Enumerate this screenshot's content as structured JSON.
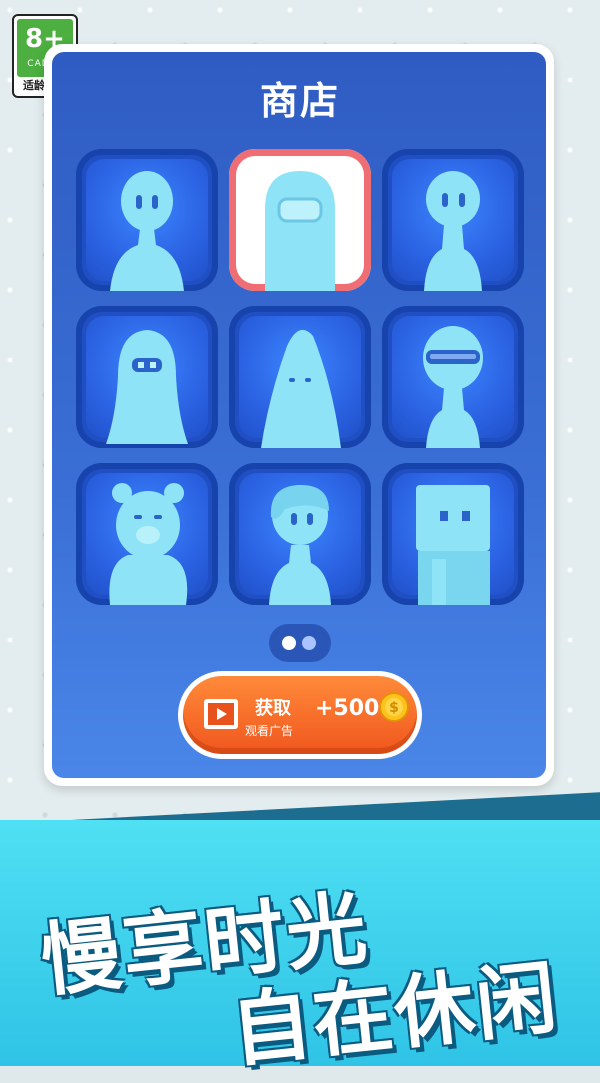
{
  "age_rating": {
    "number": "8+",
    "org": "CADPA",
    "tip": "适龄提示"
  },
  "shop": {
    "title": "商店",
    "characters": [
      {
        "name": "stick-figure-character",
        "selected": false
      },
      {
        "name": "astronaut-character",
        "selected": true
      },
      {
        "name": "alien-character",
        "selected": false
      },
      {
        "name": "ghost-character",
        "selected": false
      },
      {
        "name": "cone-character",
        "selected": false
      },
      {
        "name": "visor-character",
        "selected": false
      },
      {
        "name": "bear-character",
        "selected": false
      },
      {
        "name": "girl-character",
        "selected": false
      },
      {
        "name": "box-head-character",
        "selected": false
      }
    ],
    "pages": {
      "current": 1,
      "total": 2
    }
  },
  "reward_button": {
    "action": "获取",
    "subtext": "观看广告",
    "amount": "+500",
    "icon": "video-icon",
    "coin_icon": "coin-icon"
  },
  "slogan": {
    "line1": "慢享时光",
    "line2": "自在休闲"
  },
  "colors": {
    "panel": "#3a6fd6",
    "selected_border": "#ef6e73",
    "button": "#f0561d",
    "banner": "#4fe0f3"
  }
}
